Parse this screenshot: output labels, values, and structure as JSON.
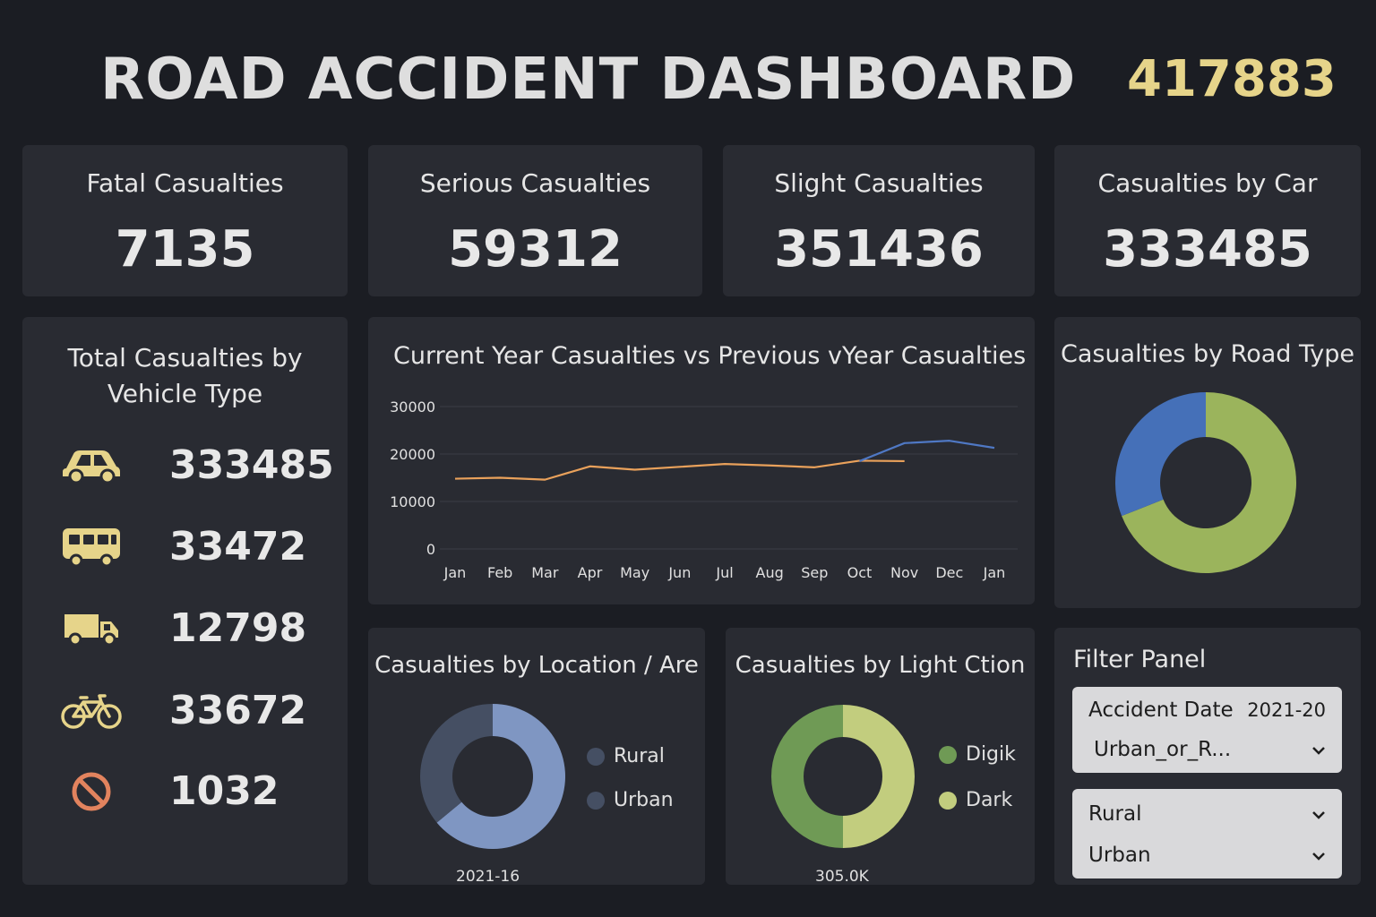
{
  "header": {
    "title": "ROAD ACCIDENT DASHBOARD",
    "total": "417883"
  },
  "kpis": [
    {
      "label": "Fatal Casualties",
      "value": "7135"
    },
    {
      "label": "Serious Casualties",
      "value": "59312"
    },
    {
      "label": "Slight Casualties",
      "value": "351436"
    },
    {
      "label": "Casualties by Car",
      "value": "333485"
    }
  ],
  "vehicle_panel": {
    "title_line1": "Total Casualties by",
    "title_line2": "Vehicle Type",
    "items": [
      {
        "icon": "car-icon",
        "value": "333485"
      },
      {
        "icon": "bus-icon",
        "value": "33472"
      },
      {
        "icon": "truck-icon",
        "value": "12798"
      },
      {
        "icon": "bicycle-icon",
        "value": "33672"
      },
      {
        "icon": "prohibited-icon",
        "value": "1032"
      }
    ]
  },
  "line_chart": {
    "title": "Current Year Casualties vs Previous vYear Casualties"
  },
  "road_type_chart": {
    "title": "Casualties by Road Type"
  },
  "location_chart": {
    "title": "Casualties by Location / Are",
    "footer": "2021-16",
    "legend": [
      "Rural",
      "Urban"
    ]
  },
  "light_chart": {
    "title": "Casualties by Light Ction",
    "footer": "305.0K",
    "legend": [
      "Digik",
      "Dark"
    ]
  },
  "filter_panel": {
    "title": "Filter Panel",
    "date_label": "Accident Date",
    "date_value": "2021-20",
    "urban_select": "Urban_or_R...",
    "option1": "Rural",
    "option2": "Urban"
  },
  "colors": {
    "accent_total": "#e6d48a",
    "line_previous": "#e9a15b",
    "line_current": "#4f78c4",
    "road_blue": "#4570b8",
    "road_green": "#9bb45c",
    "location_rural": "#454f63",
    "location_urban": "#7f96c2",
    "light_digik": "#6f9a55",
    "light_dark": "#c2cd7e",
    "vehicle_icon": "#e6d48a",
    "prohibited_icon": "#e2835e"
  },
  "chart_data": [
    {
      "type": "line",
      "title": "Current Year Casualties vs Previous vYear Casualties",
      "categories": [
        "Jan",
        "Feb",
        "Mar",
        "Apr",
        "May",
        "Jun",
        "Jul",
        "Aug",
        "Sep",
        "Oct",
        "Nov",
        "Dec",
        "Jan"
      ],
      "yticks": [
        "30000",
        "20000",
        "10000",
        "0"
      ],
      "ylim": [
        0,
        30000
      ],
      "grid": true,
      "series": [
        {
          "values": [
            14800,
            15000,
            14600,
            17400,
            16700,
            17300,
            17900,
            17600,
            17200,
            18600,
            18500,
            null,
            null
          ],
          "color": "#e9a15b"
        },
        {
          "values": [
            null,
            null,
            null,
            null,
            null,
            null,
            null,
            null,
            null,
            18500,
            22300,
            22800,
            21300
          ],
          "color": "#4f78c4"
        }
      ]
    },
    {
      "type": "pie",
      "title": "Casualties by Road Type",
      "values": [
        69,
        31
      ],
      "colors": [
        "#9bb45c",
        "#4570b8"
      ]
    },
    {
      "type": "pie",
      "title": "Casualties by Location / Are",
      "categories": [
        "Rural",
        "Urban"
      ],
      "values": [
        36,
        64
      ],
      "colors": [
        "#454f63",
        "#7f96c2"
      ]
    },
    {
      "type": "pie",
      "title": "Casualties by Light Ction",
      "categories": [
        "Digik",
        "Dark"
      ],
      "values": [
        50,
        50
      ],
      "colors": [
        "#6f9a55",
        "#c2cd7e"
      ]
    }
  ]
}
